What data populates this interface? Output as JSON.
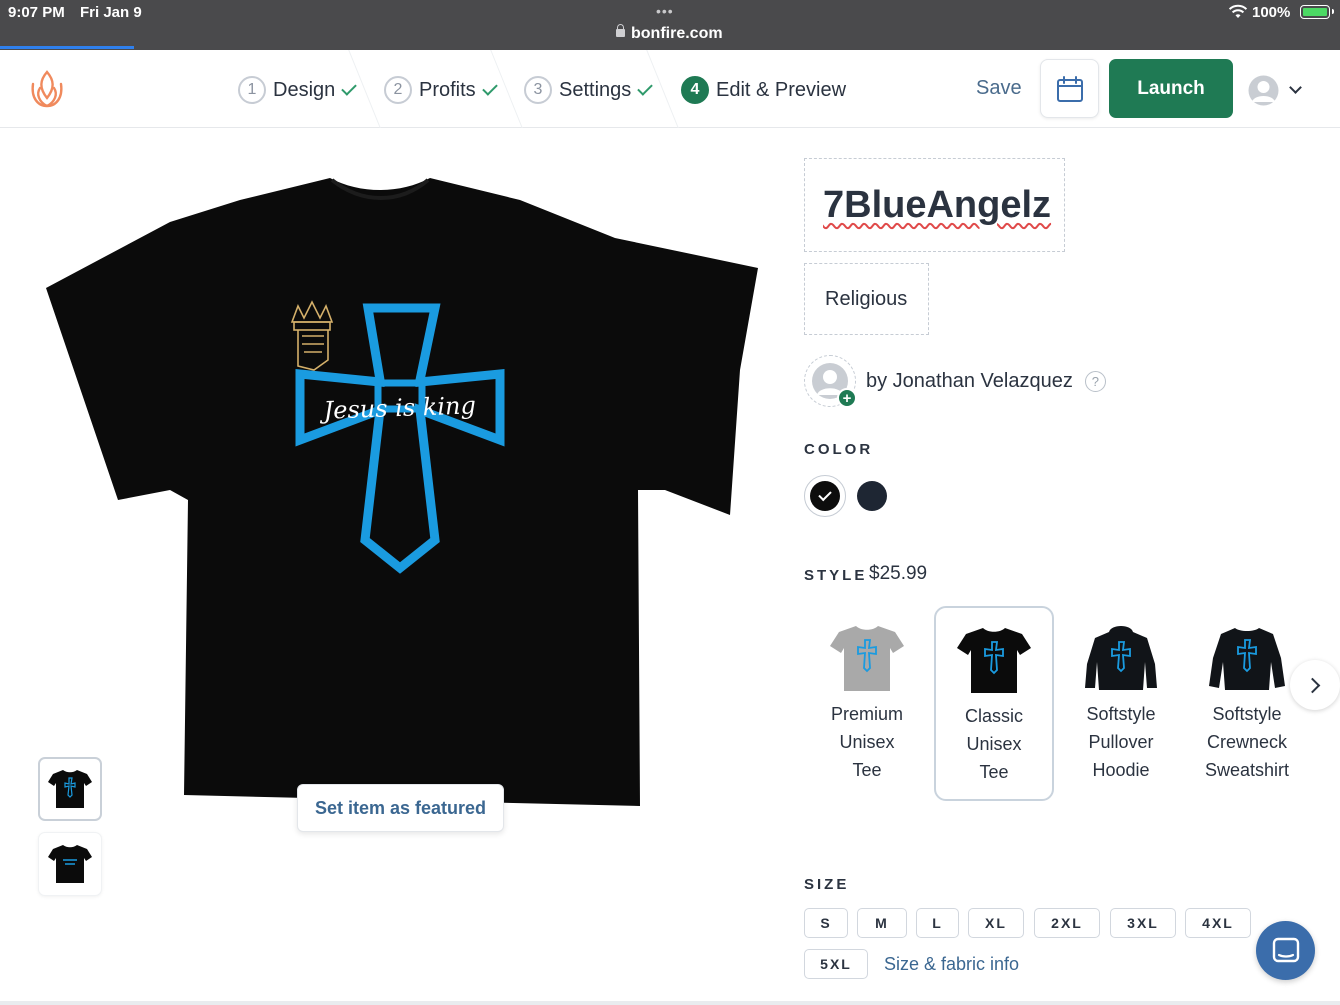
{
  "status_bar": {
    "time": "9:07 PM",
    "date": "Fri Jan 9",
    "url": "bonfire.com",
    "battery": "100%",
    "dots": "•••"
  },
  "header": {
    "steps": [
      {
        "num": "1",
        "label": "Design"
      },
      {
        "num": "2",
        "label": "Profits"
      },
      {
        "num": "3",
        "label": "Settings"
      },
      {
        "num": "4",
        "label": "Edit & Preview"
      }
    ],
    "save_label": "Save",
    "launch_label": "Launch"
  },
  "design": {
    "text": "Jesus is king"
  },
  "featured_label": "Set item as featured",
  "product": {
    "title": "7BlueAngelz",
    "tag": "Religious",
    "creator": "by Jonathan Velazquez",
    "help_glyph": "?",
    "plus_glyph": "+"
  },
  "color": {
    "label": "COLOR",
    "swatches": [
      "#0d0d0d",
      "#1e2633"
    ],
    "selected": "#0d0d0d"
  },
  "style": {
    "label": "STYLE",
    "price": "$25.99",
    "items": [
      {
        "line1": "Premium",
        "line2": "Unisex",
        "line3": "Tee",
        "color": "#a9a9a9"
      },
      {
        "line1": "Classic",
        "line2": "Unisex",
        "line3": "Tee",
        "color": "#0d0d0d"
      },
      {
        "line1": "Softstyle",
        "line2": "Pullover",
        "line3": "Hoodie",
        "color": "#111418"
      },
      {
        "line1": "Softstyle",
        "line2": "Crewneck",
        "line3": "Sweatshirt",
        "color": "#111418"
      }
    ]
  },
  "size": {
    "label": "SIZE",
    "options": [
      "S",
      "M",
      "L",
      "XL",
      "2XL",
      "3XL",
      "4XL",
      "5XL"
    ],
    "info_link": "Size & fabric info"
  },
  "colors": {
    "accent": "#1f7a54",
    "link": "#3b6791",
    "chat": "#3b6dab",
    "design_blue": "#1a9be0"
  }
}
